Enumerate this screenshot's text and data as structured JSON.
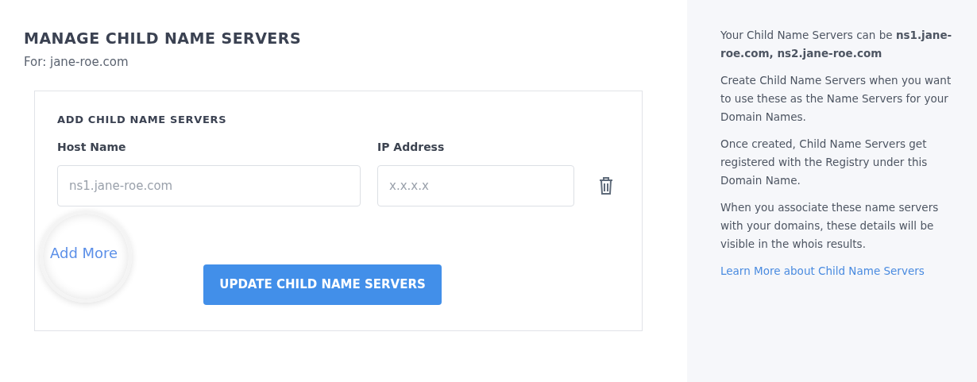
{
  "page": {
    "title": "MANAGE CHILD NAME SERVERS",
    "subtitle": "For: jane-roe.com"
  },
  "card": {
    "title": "ADD CHILD NAME SERVERS",
    "columns": [
      "Host Name",
      "IP Address"
    ],
    "rows": [
      {
        "host_placeholder": "ns1.jane-roe.com",
        "ip_placeholder": "x.x.x.x"
      }
    ],
    "add_more": {
      "label": "Add More",
      "highlighted": true
    },
    "submit": "UPDATE CHILD NAME SERVERS"
  },
  "sidebar": {
    "paragraphs": [
      "Your Child Name Servers can be **ns1.jane-roe.com, ns2.jane-roe.com**",
      "Create Child Name Servers when you want to use these as the Name Servers for your Domain Names.",
      "Once created, Child Name Servers get registered with the Registry under this Domain Name.",
      "When you associate these name servers with your domains, these details will be visible in the whois results."
    ],
    "link": "Learn More about Child Name Servers"
  }
}
